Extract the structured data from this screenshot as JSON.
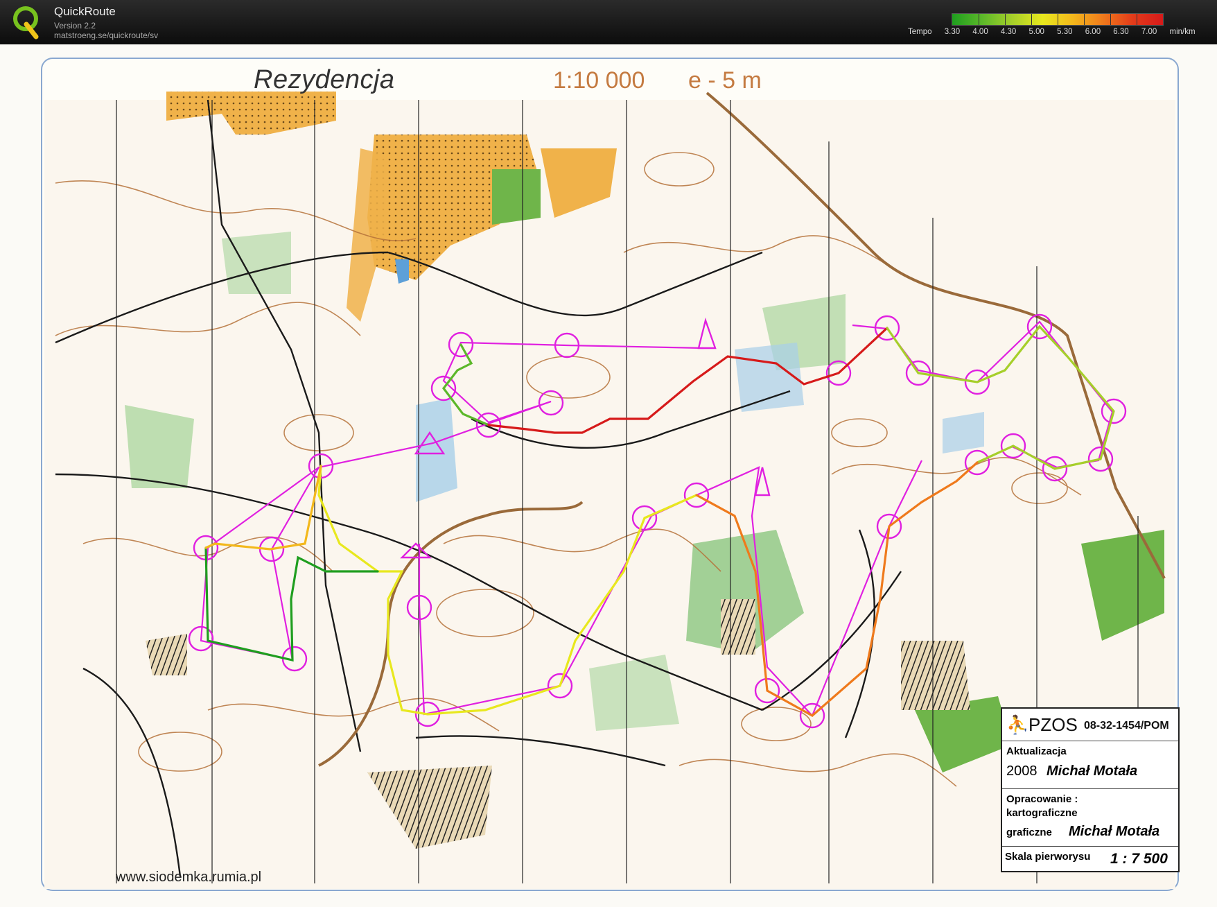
{
  "app": {
    "name": "QuickRoute",
    "version": "Version 2.2",
    "url": "matstroeng.se/quickroute/sv"
  },
  "pace_legend": {
    "label": "Tempo",
    "ticks": [
      "3.30",
      "4.00",
      "4.30",
      "5.00",
      "5.30",
      "6.00",
      "6.30",
      "7.00"
    ],
    "unit": "min/km",
    "colors": [
      "#1f9e1f",
      "#5cb82a",
      "#a6cf2a",
      "#e8e81e",
      "#f3b81c",
      "#ef7a1c",
      "#e33b1a",
      "#d61a1a"
    ]
  },
  "map": {
    "title": "Rezydencja",
    "scale": "1:10 000",
    "equidistance": "e - 5 m",
    "website": "www.siodemka.rumia.pl",
    "infobox": {
      "org": "PZOS",
      "code": "08-32-1454/POM",
      "update_label": "Aktualizacja",
      "update_year": "2008",
      "update_author": "Michał Motała",
      "prep_line1": "Opracowanie :",
      "prep_line2": "kartograficzne",
      "prep_line3": "graficzne",
      "prep_author": "Michał Motała",
      "orig_scale_label": "Skala pierworysu",
      "orig_scale_value": "1 : 7 500"
    }
  },
  "colors": {
    "course": "#e020e0",
    "route_start": "#2a9a2a",
    "contour": "#b5723a",
    "open_land": "#f0b24a",
    "vegetation": "#8cc77f",
    "water": "#a8cfe8"
  }
}
